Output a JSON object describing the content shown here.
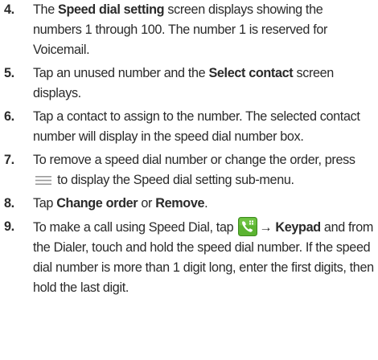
{
  "steps": [
    {
      "number": "4.",
      "t1": "The ",
      "b1": "Speed dial setting",
      "t2": " screen displays showing the numbers 1 through 100. The number 1 is reserved for Voicemail."
    },
    {
      "number": "5.",
      "t1": "Tap an unused number and the ",
      "b1": "Select contact",
      "t2": " screen displays."
    },
    {
      "number": "6.",
      "t1": "Tap a contact to assign to the number. The selected contact number will display in the speed dial number box."
    },
    {
      "number": "7.",
      "t1": "To remove a speed dial number or change the order, press ",
      "icon": "menu-icon",
      "t2": " to display the Speed dial setting sub-menu."
    },
    {
      "number": "8.",
      "t1": "Tap ",
      "b1": "Change order",
      "t2": " or ",
      "b2": "Remove",
      "t3": "."
    },
    {
      "number": "9.",
      "t1": "To make a call using Speed Dial, tap ",
      "icon": "phone-app-icon",
      "arrow": "→",
      "b1": "Keypad",
      "t2": " and from the Dialer, touch and hold the speed dial number. If the speed dial number is more than 1 digit long, enter the first digits, then hold the last digit."
    }
  ],
  "colors": {
    "text": "#2a2a2a",
    "menu_icon": "#9a9a9a",
    "phone_icon_bg": "#5bb431",
    "phone_icon_fg": "#ffffff"
  }
}
